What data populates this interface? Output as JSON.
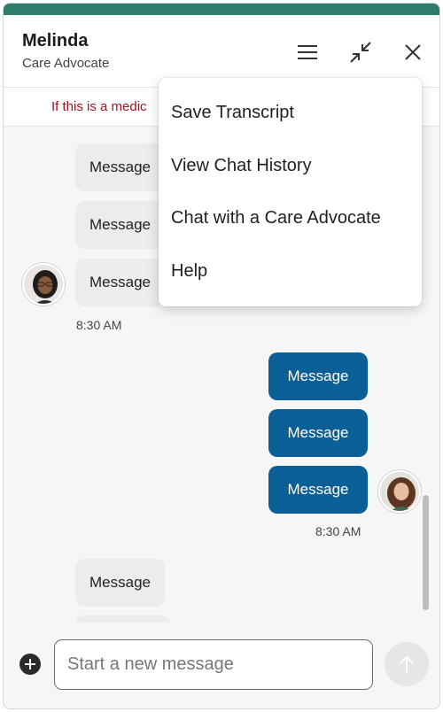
{
  "header": {
    "agent_name": "Melinda",
    "agent_role": "Care Advocate",
    "icons": [
      "menu-icon",
      "minimize-icon",
      "close-icon"
    ],
    "accent_color": "#2e7d6b"
  },
  "banner": {
    "text": "If this is a medic"
  },
  "menu": {
    "items": [
      {
        "label": "Save Transcript"
      },
      {
        "label": "View Chat History"
      },
      {
        "label": "Chat with a Care Advocate"
      },
      {
        "label": "Help"
      }
    ]
  },
  "messages": {
    "incoming_group_1": [
      "Message",
      "Message",
      "Message"
    ],
    "incoming_time": "8:30 AM",
    "outgoing_group": [
      "Message",
      "Message",
      "Message"
    ],
    "outgoing_time": "8:30 AM",
    "incoming_group_2": [
      "Message"
    ],
    "outgoing_color": "#0b5f97",
    "incoming_color": "#ebedeb"
  },
  "composer": {
    "placeholder": "Start a new message",
    "value": "",
    "plus_icon": "plus-circle-icon",
    "send_icon": "arrow-up-icon"
  }
}
